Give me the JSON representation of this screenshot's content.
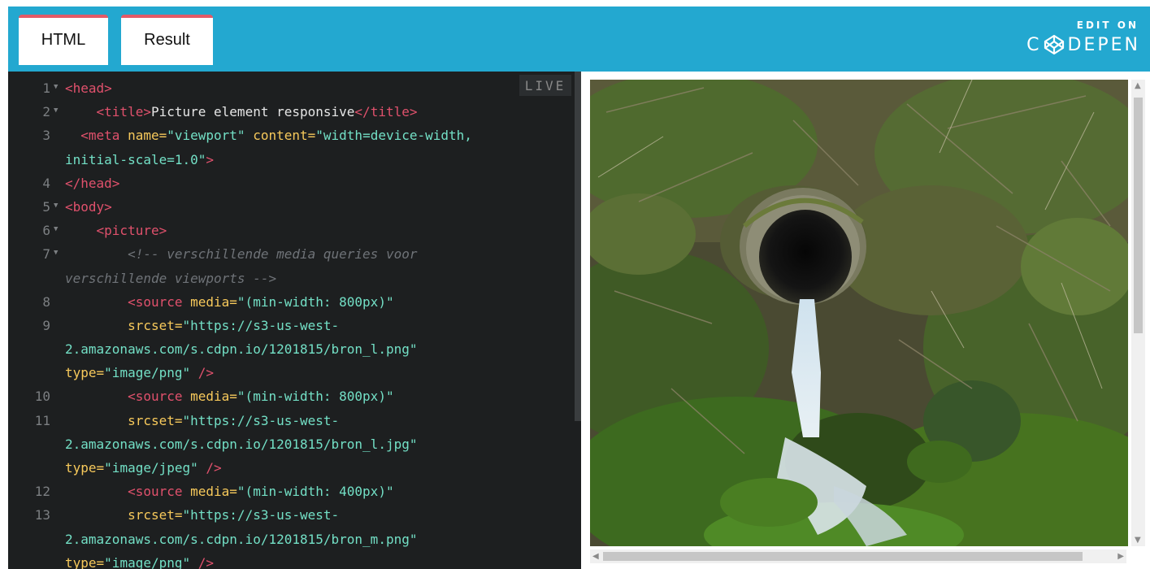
{
  "tabs": [
    {
      "label": "HTML"
    },
    {
      "label": "Result"
    }
  ],
  "branding": {
    "edit_on": "EDIT ON",
    "logo_text": "CODEPEN"
  },
  "editor": {
    "live_badge": "LIVE",
    "line_numbers": [
      "1",
      "2",
      "3",
      "4",
      "5",
      "6",
      "7",
      "8",
      "9",
      "10",
      "11",
      "12",
      "13"
    ]
  },
  "colors": {
    "header": "#23a8d0",
    "tab_accent": "#e35a67",
    "editor_bg": "#1d1f20",
    "tag": "#e0516c",
    "attr": "#f7c95b",
    "string": "#73e0c6",
    "comment": "#6f7378"
  },
  "result": {
    "image_alt": "Drainage pipe in mossy hillside with flowing water"
  }
}
